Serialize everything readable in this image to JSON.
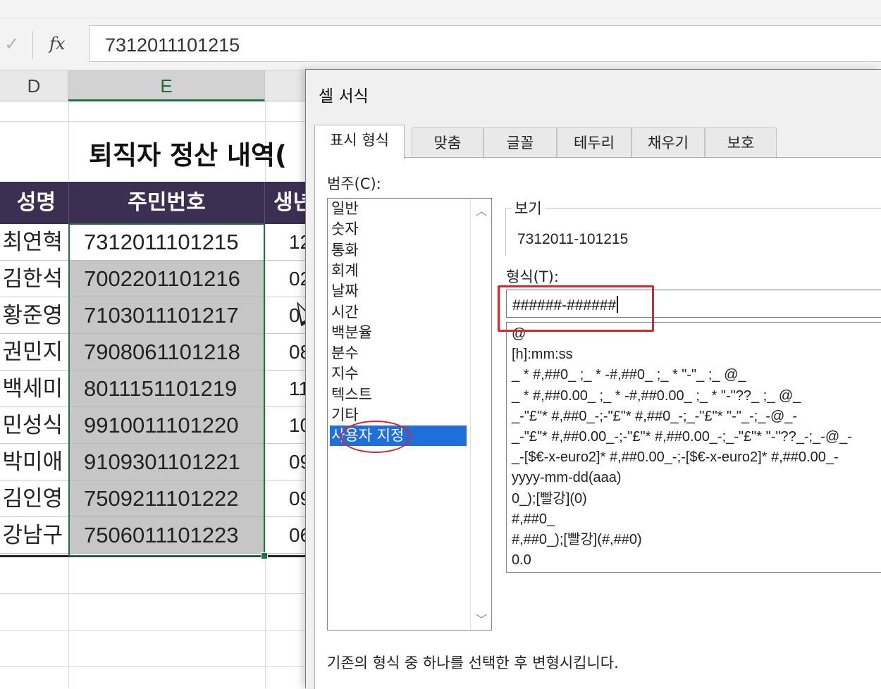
{
  "formula_bar": {
    "cancel_icon": "✓",
    "fx_label": "fx",
    "value": "7312011101215"
  },
  "sheet": {
    "columns": [
      "D",
      "E"
    ],
    "title": "퇴직자 정산 내역(",
    "headers": {
      "name": "성명",
      "id": "주민번호",
      "birth": "생년"
    },
    "rows": [
      {
        "name": "최연혁",
        "id": "7312011101215",
        "num": "12"
      },
      {
        "name": "김한석",
        "id": "7002201101216",
        "num": "02"
      },
      {
        "name": "황준영",
        "id": "7103011101217",
        "num": "0"
      },
      {
        "name": "권민지",
        "id": "7908061101218",
        "num": "08"
      },
      {
        "name": "백세미",
        "id": "8011151101219",
        "num": "11"
      },
      {
        "name": "민성식",
        "id": "9910011101220",
        "num": "10"
      },
      {
        "name": "박미애",
        "id": "9109301101221",
        "num": "09"
      },
      {
        "name": "김인영",
        "id": "7509211101222",
        "num": "09"
      },
      {
        "name": "강남구",
        "id": "7506011101223",
        "num": "06"
      }
    ]
  },
  "dialog": {
    "title": "셀 서식",
    "tabs": [
      "표시 형식",
      "맞춤",
      "글꼴",
      "테두리",
      "채우기",
      "보호"
    ],
    "category_label": "범주(C):",
    "categories": [
      "일반",
      "숫자",
      "통화",
      "회계",
      "날짜",
      "시간",
      "백분율",
      "분수",
      "지수",
      "텍스트",
      "기타",
      "사용자 지정"
    ],
    "selected_category": "사용자 지정",
    "preview_label": "보기",
    "preview_value": "7312011-101215",
    "format_label": "형식(T):",
    "format_value": "######-######",
    "format_list": [
      "@",
      "[h]:mm:ss",
      "_ * #,##0_ ;_ * -#,##0_ ;_ * \"-\"_ ;_ @_",
      "_ * #,##0.00_ ;_ * -#,##0.00_ ;_ * \"-\"??_ ;_ @_",
      "_-\"£\"* #,##0_-;-\"£\"* #,##0_-;_-\"£\"* \"-\"_-;_-@_-",
      "_-\"£\"* #,##0.00_-;-\"£\"* #,##0.00_-;_-\"£\"* \"-\"??_-;_-@_-",
      "_-[$€-x-euro2]* #,##0.00_-;-[$€-x-euro2]* #,##0.00_-",
      "yyyy-mm-dd(aaa)",
      "0_);[빨강](0)",
      "#,##0_",
      "#,##0_);[빨강](#,##0)",
      "0.0"
    ],
    "hint": "기존의 형식 중 하나를 선택한 후 변형시킵니다.",
    "highlight_color": "#e0222e",
    "selection_color": "#1e6fd9"
  }
}
